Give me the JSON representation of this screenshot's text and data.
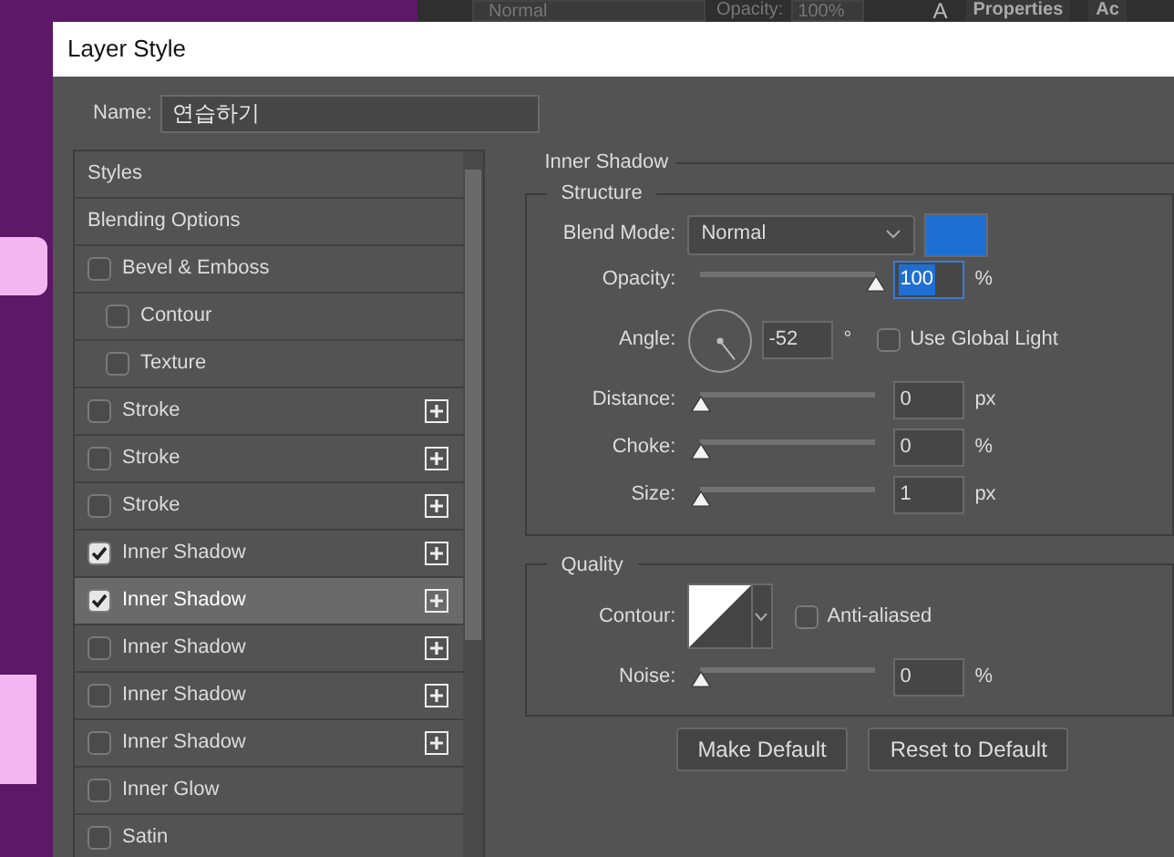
{
  "background": {
    "blend_mode": "Normal",
    "opacity_label": "Opacity:",
    "opacity_value": "100%",
    "panel_glyph": "A",
    "tabs": [
      {
        "label": "Properties"
      },
      {
        "label": "Ac"
      }
    ]
  },
  "dialog": {
    "title": "Layer Style",
    "name": {
      "label": "Name:",
      "value": "연습하기"
    },
    "styles": [
      {
        "label": "Styles",
        "kind": "header",
        "selected": false
      },
      {
        "label": "Blending Options",
        "kind": "header",
        "selected": false
      },
      {
        "label": "Bevel & Emboss",
        "kind": "effect",
        "checked": false,
        "selected": false,
        "add_button": false,
        "children": [
          {
            "label": "Contour",
            "kind": "effect",
            "checked": false,
            "selected": false,
            "add_button": false
          },
          {
            "label": "Texture",
            "kind": "effect",
            "checked": false,
            "selected": false,
            "add_button": false
          }
        ]
      },
      {
        "label": "Stroke",
        "kind": "effect",
        "checked": false,
        "selected": false,
        "add_button": true
      },
      {
        "label": "Stroke",
        "kind": "effect",
        "checked": false,
        "selected": false,
        "add_button": true
      },
      {
        "label": "Stroke",
        "kind": "effect",
        "checked": false,
        "selected": false,
        "add_button": true
      },
      {
        "label": "Inner Shadow",
        "kind": "effect",
        "checked": true,
        "selected": false,
        "add_button": true
      },
      {
        "label": "Inner Shadow",
        "kind": "effect",
        "checked": true,
        "selected": true,
        "add_button": true
      },
      {
        "label": "Inner Shadow",
        "kind": "effect",
        "checked": false,
        "selected": false,
        "add_button": true
      },
      {
        "label": "Inner Shadow",
        "kind": "effect",
        "checked": false,
        "selected": false,
        "add_button": true
      },
      {
        "label": "Inner Shadow",
        "kind": "effect",
        "checked": false,
        "selected": false,
        "add_button": true
      },
      {
        "label": "Inner Glow",
        "kind": "effect",
        "checked": false,
        "selected": false,
        "add_button": false
      },
      {
        "label": "Satin",
        "kind": "effect",
        "checked": false,
        "selected": false,
        "add_button": false
      }
    ],
    "section_title": "Inner Shadow",
    "structure": {
      "legend": "Structure",
      "blend_mode": {
        "label": "Blend Mode:",
        "value": "Normal",
        "color": "#1f6fd3"
      },
      "opacity": {
        "label": "Opacity:",
        "level": 1,
        "value": "100",
        "unit": "%",
        "focused": true
      },
      "angle": {
        "label": "Angle:",
        "value": "-52",
        "unit": "°"
      },
      "use_global_light": {
        "label": "Use Global Light",
        "checked": false
      },
      "sliders": [
        {
          "label": "Distance:",
          "level": 0,
          "value": "0",
          "unit": "px"
        },
        {
          "label": "Choke:",
          "level": 0,
          "value": "0",
          "unit": "%"
        },
        {
          "label": "Size:",
          "level": 0,
          "value": "1",
          "unit": "px"
        }
      ]
    },
    "quality": {
      "legend": "Quality",
      "contour_label": "Contour:",
      "anti_aliased": {
        "label": "Anti-aliased",
        "checked": false
      },
      "noise": {
        "label": "Noise:",
        "level": 0,
        "value": "0",
        "unit": "%"
      }
    },
    "buttons": [
      "Make Default",
      "Reset to Default"
    ]
  }
}
